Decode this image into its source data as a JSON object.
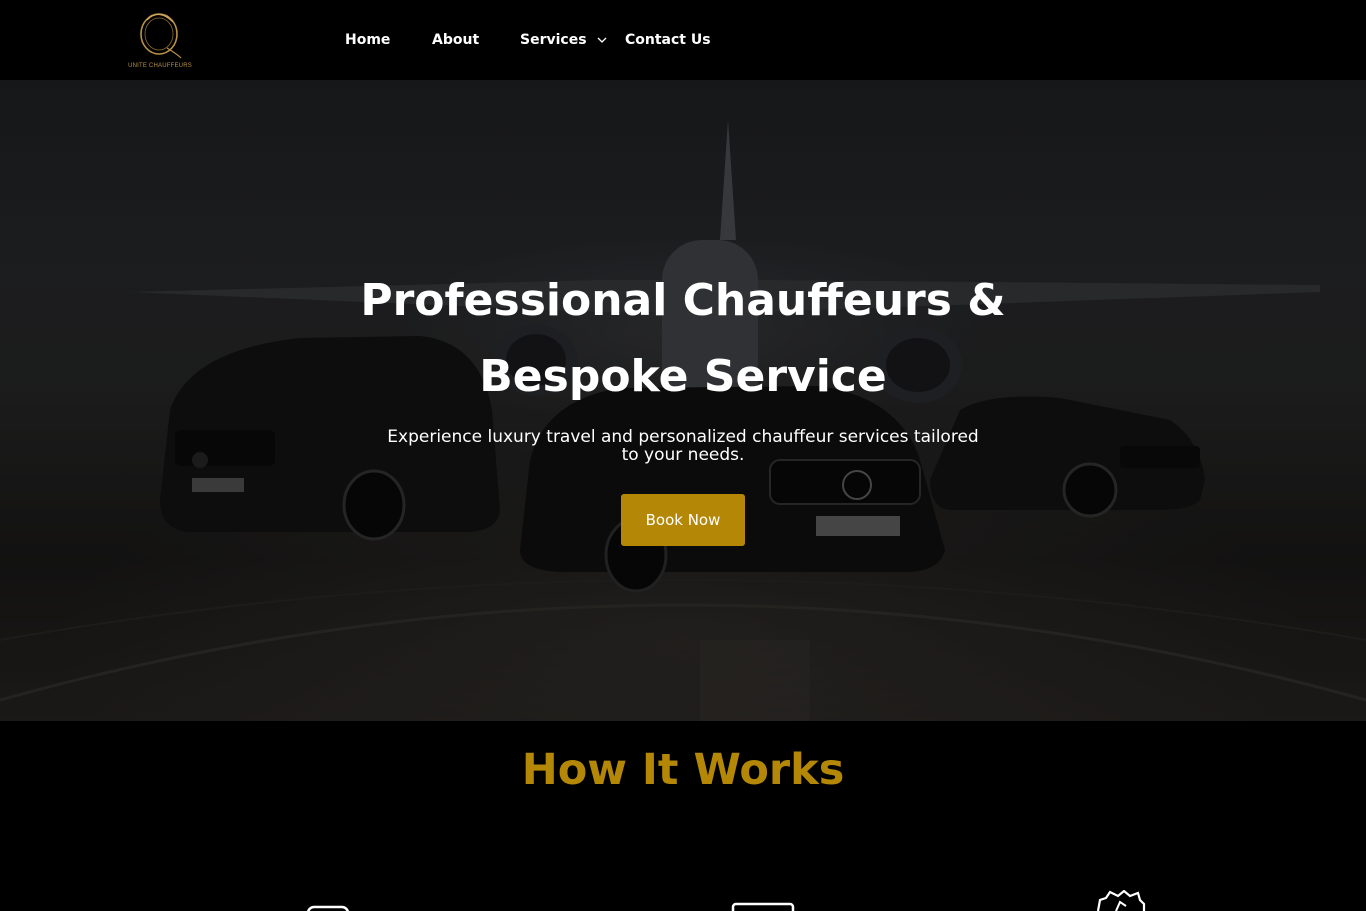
{
  "brand": {
    "name": "UNITE CHAUFFEURS",
    "accent_color": "#b48707",
    "logo_ring_color": "#b8914a"
  },
  "nav": {
    "items": [
      {
        "label": "Home"
      },
      {
        "label": "About"
      },
      {
        "label": "Services",
        "icon": "chevron-down-icon"
      },
      {
        "label": "Contact Us"
      }
    ]
  },
  "hero": {
    "title": "Professional Chauffeurs & Bespoke Service",
    "subtitle": "Experience luxury travel and personalized chauffeur services tailored to your needs.",
    "cta_label": "Book Now",
    "background": "airplane-and-cars-photo"
  },
  "how_it_works": {
    "title": "How It Works",
    "step_icons": [
      "phone-icon",
      "laptop-icon",
      "badge-icon"
    ]
  }
}
